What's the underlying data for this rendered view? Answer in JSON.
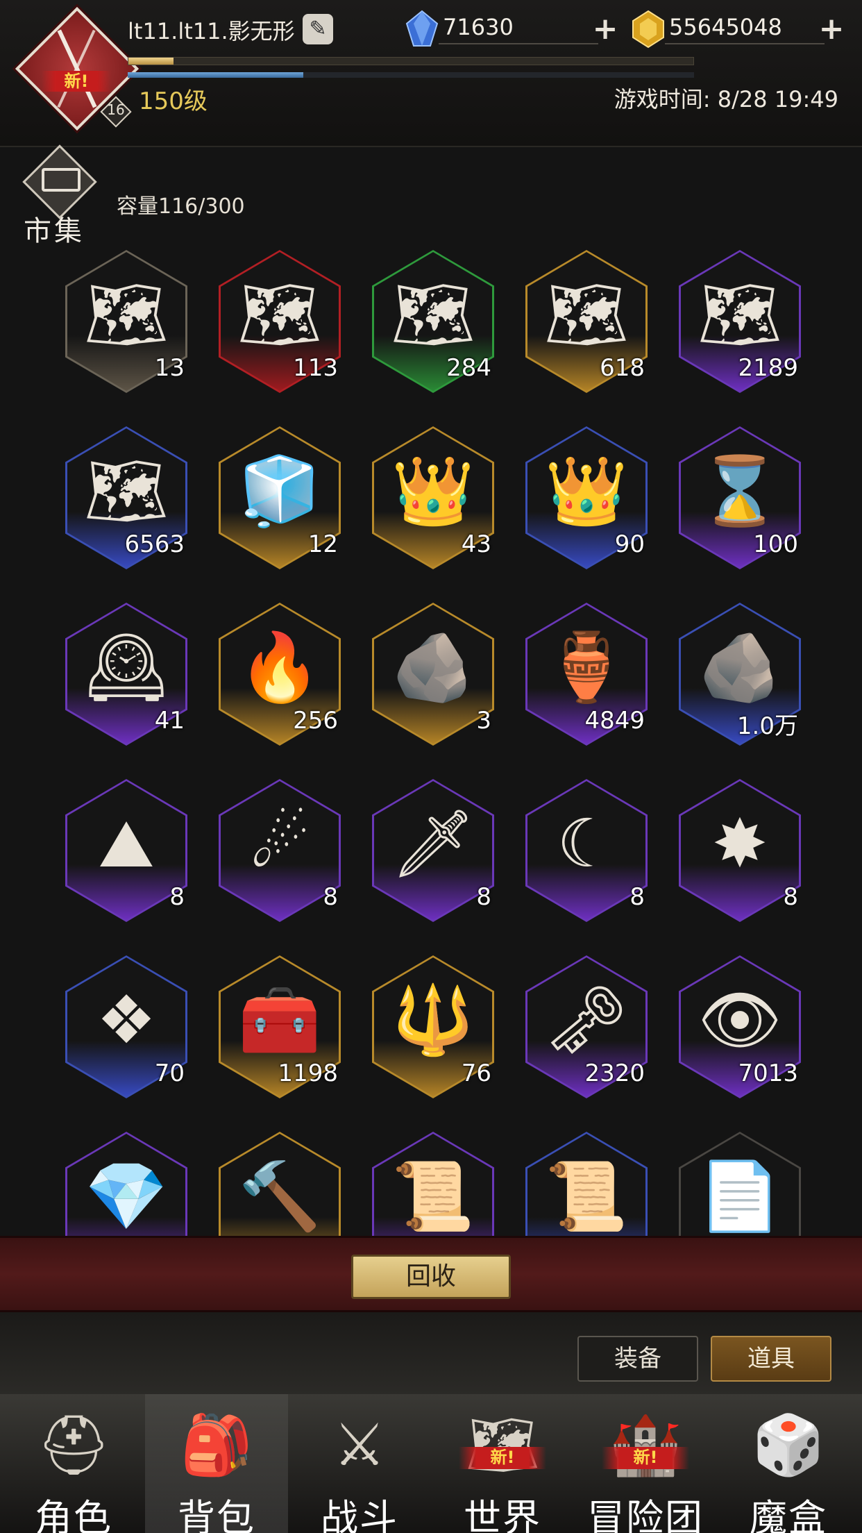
{
  "player": {
    "name": "lt11.lt11.影无形",
    "avatar_badge": "新!",
    "avatar_level": "16",
    "level": "150级",
    "exp_progress": 0.08,
    "mp_progress": 0.31
  },
  "currency": {
    "diamond": "71630",
    "gold": "55645048"
  },
  "game_time": "游戏时间: 8/28 19:49",
  "market": {
    "label": "市集",
    "capacity": "容量116/300"
  },
  "items": [
    {
      "name": "map-chest-gray",
      "icon": "🗺",
      "count": "13",
      "rarity": "gray"
    },
    {
      "name": "map-chest-red",
      "icon": "🗺",
      "count": "113",
      "rarity": "red"
    },
    {
      "name": "map-chest-green",
      "icon": "🗺",
      "count": "284",
      "rarity": "green"
    },
    {
      "name": "map-chest-gold",
      "icon": "🗺",
      "count": "618",
      "rarity": "gold"
    },
    {
      "name": "map-chest-purple",
      "icon": "🗺",
      "count": "2189",
      "rarity": "purple"
    },
    {
      "name": "map-crate-blue",
      "icon": "🗺",
      "count": "6563",
      "rarity": "blue"
    },
    {
      "name": "crystal-box",
      "icon": "🧊",
      "count": "12",
      "rarity": "gold"
    },
    {
      "name": "ruby-chest-gold",
      "icon": "👑",
      "count": "43",
      "rarity": "gold"
    },
    {
      "name": "ruby-chest-blue",
      "icon": "👑",
      "count": "90",
      "rarity": "blue"
    },
    {
      "name": "hourglass",
      "icon": "⌛",
      "count": "100",
      "rarity": "purple"
    },
    {
      "name": "clock",
      "icon": "🕰",
      "count": "41",
      "rarity": "purple"
    },
    {
      "name": "flame",
      "icon": "🔥",
      "count": "256",
      "rarity": "gold"
    },
    {
      "name": "stone",
      "icon": "🪨",
      "count": "3",
      "rarity": "gold"
    },
    {
      "name": "jar",
      "icon": "🏺",
      "count": "4849",
      "rarity": "purple"
    },
    {
      "name": "ore",
      "icon": "🪨",
      "count": "1.0万",
      "rarity": "blue"
    },
    {
      "name": "dust",
      "icon": "⛰",
      "count": "8",
      "rarity": "purple"
    },
    {
      "name": "fireball",
      "icon": "☄",
      "count": "8",
      "rarity": "purple"
    },
    {
      "name": "shard",
      "icon": "🗡",
      "count": "8",
      "rarity": "purple"
    },
    {
      "name": "crescent",
      "icon": "☾",
      "count": "8",
      "rarity": "purple"
    },
    {
      "name": "burst",
      "icon": "✸",
      "count": "8",
      "rarity": "purple"
    },
    {
      "name": "laurel-gem",
      "icon": "❖",
      "count": "70",
      "rarity": "blue"
    },
    {
      "name": "treasure-chest",
      "icon": "🧰",
      "count": "1198",
      "rarity": "gold"
    },
    {
      "name": "crystal-key",
      "icon": "🔱",
      "count": "76",
      "rarity": "gold"
    },
    {
      "name": "key",
      "icon": "🗝",
      "count": "2320",
      "rarity": "purple"
    },
    {
      "name": "dragon-eye",
      "icon": "👁",
      "count": "7013",
      "rarity": "purple"
    },
    {
      "name": "crystals",
      "icon": "💎",
      "count": "",
      "rarity": "purple"
    },
    {
      "name": "hammer",
      "icon": "🔨",
      "count": "",
      "rarity": "gold"
    },
    {
      "name": "sealed-scroll",
      "icon": "📜",
      "count": "",
      "rarity": "purple"
    },
    {
      "name": "scroll",
      "icon": "📜",
      "count": "",
      "rarity": "blue"
    },
    {
      "name": "torn-paper",
      "icon": "📄",
      "count": "",
      "rarity": "dim"
    }
  ],
  "actions": {
    "recycle": "回收"
  },
  "tabs": {
    "equipment": "装备",
    "items": "道具"
  },
  "nav": [
    {
      "key": "character",
      "label": "角色",
      "icon": "⛑",
      "new": ""
    },
    {
      "key": "backpack",
      "label": "背包",
      "icon": "🎒",
      "new": ""
    },
    {
      "key": "battle",
      "label": "战斗",
      "icon": "⚔",
      "new": ""
    },
    {
      "key": "world",
      "label": "世界",
      "icon": "🗺",
      "new": "新!"
    },
    {
      "key": "adventure-team",
      "label": "冒险团",
      "icon": "🏰",
      "new": "新!"
    },
    {
      "key": "magic-box",
      "label": "魔盒",
      "icon": "🎲",
      "new": ""
    }
  ],
  "colors": {
    "accent_gold": "#e6c95a",
    "recycle_bar": "#521a1a",
    "active_tab": "#7a5520"
  }
}
